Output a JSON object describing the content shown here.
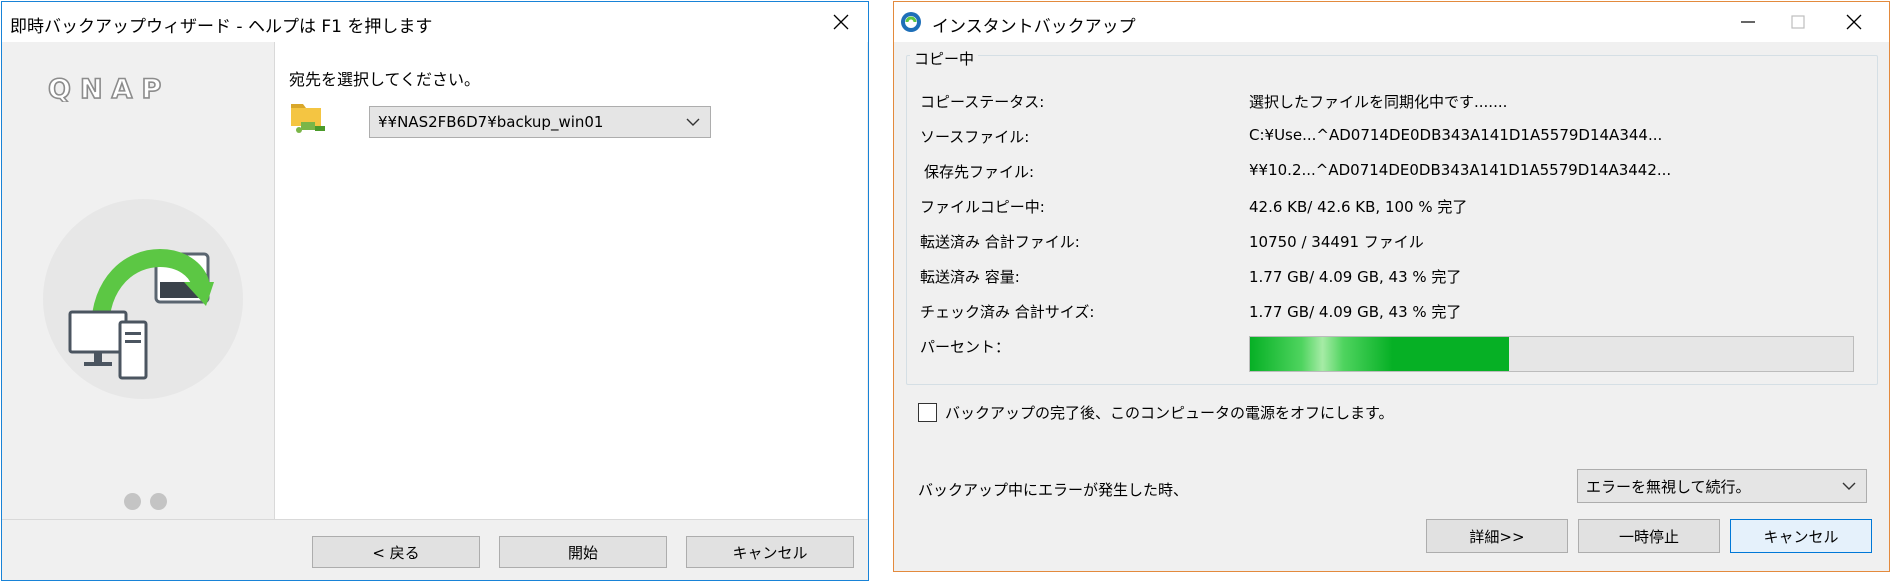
{
  "wizard": {
    "title": "即時バックアップウィザード - ヘルプは F1 を押します",
    "logo_text": "QNAP",
    "prompt": "宛先を選択してください。",
    "destination_value": "¥¥NAS2FB6D7¥backup_win01",
    "buttons": {
      "back": "< 戻る",
      "start": "開始",
      "cancel": "キャンセル"
    }
  },
  "instant_backup": {
    "title": "インスタントバックアップ",
    "group_label": "コピー中",
    "rows": [
      {
        "label": "コピーステータス:",
        "value": "選択したファイルを同期化中です......."
      },
      {
        "label": "ソースファイル:",
        "value": "C:¥Use...^AD0714DE0DB343A141D1A5579D14A344..."
      },
      {
        "label": "保存先ファイル:",
        "value": "¥¥10.2...^AD0714DE0DB343A141D1A5579D14A3442..."
      },
      {
        "label": "ファイルコピー中:",
        "value": "42.6 KB/ 42.6 KB,  100 % 完了"
      },
      {
        "label": "転送済み 合計ファイル:",
        "value": "10750 / 34491 ファイル"
      },
      {
        "label": "転送済み 容量:",
        "value": "1.77 GB/ 4.09 GB,  43 % 完了"
      },
      {
        "label": "チェック済み 合計サイズ:",
        "value": "1.77 GB/ 4.09 GB,  43 % 完了"
      }
    ],
    "percent_label": "パーセント：",
    "progress_percent": 43,
    "shutdown_checkbox_label": "バックアップの完了後、このコンピュータの電源をオフにします。",
    "shutdown_checked": false,
    "error_label": "バックアップ中にエラーが発生した時、",
    "error_option": "エラーを無視して続行。",
    "buttons": {
      "details": "詳細>>",
      "pause": "一時停止",
      "cancel": "キャンセル"
    }
  },
  "colors": {
    "accent_blue": "#1883d7",
    "window_border_orange": "#e38a3d",
    "progress_green": "#06b025",
    "arrow_green": "#5cc744"
  },
  "icons": [
    "close-icon",
    "minimize-icon",
    "maximize-icon",
    "chevron-down-icon",
    "folder-icon",
    "backup-illustration",
    "app-icon"
  ]
}
